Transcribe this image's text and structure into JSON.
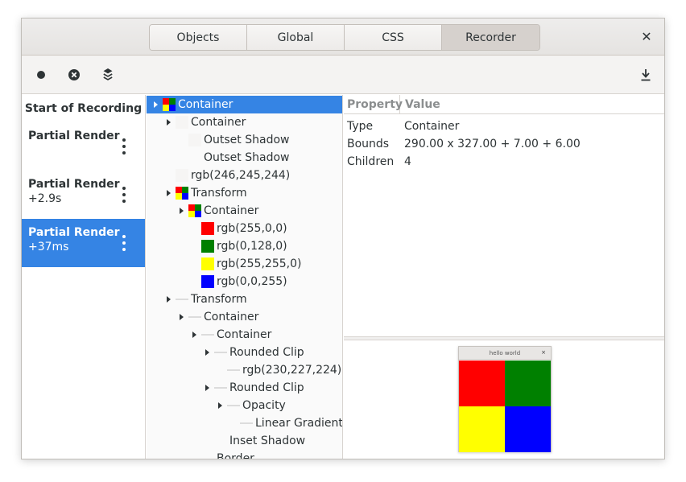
{
  "tabs": [
    {
      "label": "Objects"
    },
    {
      "label": "Global"
    },
    {
      "label": "CSS"
    },
    {
      "label": "Recorder"
    }
  ],
  "active_tab": "Recorder",
  "icons": {
    "record": "record-icon",
    "stop": "stop-icon",
    "layers": "layers-icon",
    "download": "download-icon",
    "close": "close-icon",
    "more": "more-vertical-icon"
  },
  "recordings": {
    "start_label": "Start of Recording",
    "items": [
      {
        "title": "Partial Render",
        "subtitle": ""
      },
      {
        "title": "Partial Render",
        "subtitle": "+2.9s"
      },
      {
        "title": "Partial Render",
        "subtitle": "+37ms"
      }
    ]
  },
  "tree": [
    {
      "label": "Container",
      "icon": "multi",
      "expander": true,
      "selected": true
    },
    {
      "label": "Container",
      "icon": "blank",
      "expander": true
    },
    {
      "label": "Outset Shadow",
      "icon": "blank"
    },
    {
      "label": "Outset Shadow",
      "icon": "none"
    },
    {
      "label": "rgb(246,245,244)",
      "icon": "blank"
    },
    {
      "label": "Transform",
      "icon": "multi",
      "expander": true
    },
    {
      "label": "Container",
      "icon": "multi",
      "expander": true
    },
    {
      "label": "rgb(255,0,0)",
      "icon": "color",
      "color": "#ff0000"
    },
    {
      "label": "rgb(0,128,0)",
      "icon": "color",
      "color": "#008000"
    },
    {
      "label": "rgb(255,255,0)",
      "icon": "color",
      "color": "#ffff00"
    },
    {
      "label": "rgb(0,0,255)",
      "icon": "color",
      "color": "#0000ff"
    },
    {
      "label": "Transform",
      "icon": "line",
      "expander": true
    },
    {
      "label": "Container",
      "icon": "line",
      "expander": true
    },
    {
      "label": "Container",
      "icon": "line",
      "expander": true
    },
    {
      "label": "Rounded Clip",
      "icon": "line",
      "expander": true
    },
    {
      "label": "rgb(230,227,224)",
      "icon": "line"
    },
    {
      "label": "Rounded Clip",
      "icon": "line",
      "expander": true
    },
    {
      "label": "Opacity",
      "icon": "line",
      "expander": true
    },
    {
      "label": "Linear Gradient",
      "icon": "line"
    },
    {
      "label": "Inset Shadow",
      "icon": "none"
    },
    {
      "label": "Border",
      "icon": "none"
    }
  ],
  "properties": {
    "header_property": "Property",
    "header_value": "Value",
    "rows": [
      {
        "key": "Type",
        "value": "Container"
      },
      {
        "key": "Bounds",
        "value": "290.00 x 327.00 + 7.00 + 6.00"
      },
      {
        "key": "Children",
        "value": "4"
      }
    ]
  },
  "preview": {
    "title": "hello world",
    "close": "×",
    "colors": [
      "#ff0000",
      "#008000",
      "#ffff00",
      "#0000ff"
    ]
  },
  "accent_color": "#3584e4"
}
